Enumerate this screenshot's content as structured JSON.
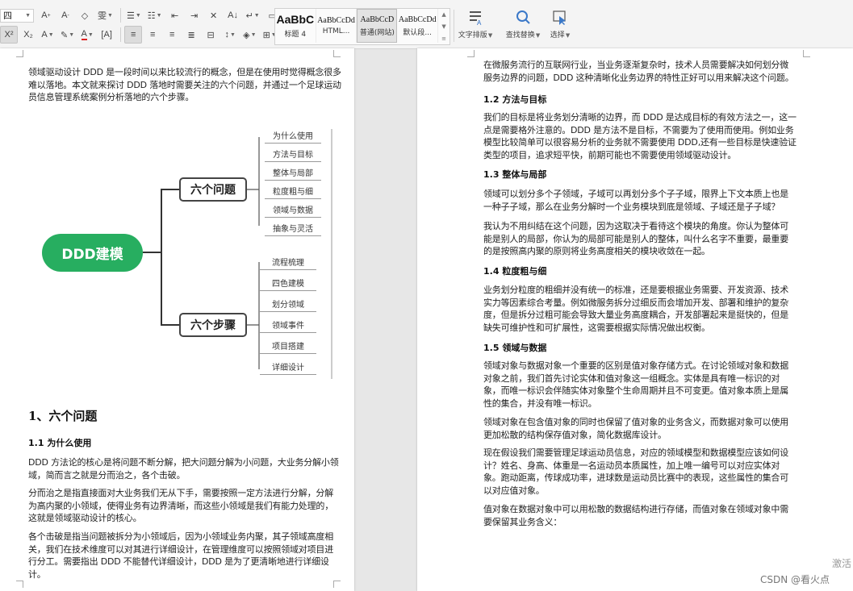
{
  "toolbar": {
    "font_size_value": "四",
    "style_gallery": [
      {
        "sample": "AaBbC",
        "name": "标题 4"
      },
      {
        "sample": "AaBbCcDd",
        "name": "HTML..."
      },
      {
        "sample": "AaBbCcD",
        "name": "普通(网站)"
      },
      {
        "sample": "AaBbCcDd",
        "name": "默认段..."
      }
    ],
    "text_layout_label": "文字排版",
    "find_replace_label": "查找替换",
    "select_label": "选择"
  },
  "left_page": {
    "intro": "领域驱动设计 DDD 是一段时间以来比较流行的概念，但是在使用时觉得概念很多难以落地。本文就来探讨 DDD 落地时需要关注的六个问题，并通过一个足球运动员信息管理系统案例分析落地的六个步骤。",
    "mindmap": {
      "root": "DDD建模",
      "branches": [
        {
          "label": "六个问题",
          "leaves": [
            "为什么使用",
            "方法与目标",
            "整体与局部",
            "粒度粗与细",
            "领域与数据",
            "抽象与灵活"
          ]
        },
        {
          "label": "六个步骤",
          "leaves": [
            "流程梳理",
            "四色建模",
            "划分领域",
            "领域事件",
            "项目搭建",
            "详细设计"
          ]
        }
      ]
    },
    "section_title": "1、六个问题",
    "subsection_title": "1.1  为什么使用",
    "paragraphs": [
      "DDD 方法论的核心是将问题不断分解，把大问题分解为小问题，大业务分解小领域，简而言之就是分而治之，各个击破。",
      "分而治之是指直接面对大业务我们无从下手，需要按照一定方法进行分解，分解为高内聚的小领域，使得业务有边界清晰，而这些小领域是我们有能力处理的，这就是领域驱动设计的核心。",
      "各个击破是指当问题被拆分为小领域后，因为小领域业务内聚，其子领域高度相关，我们在技术维度可以对其进行详细设计，在管理维度可以按照领域对项目进行分工。需要指出 DDD 不能替代详细设计，DDD 是为了更清晰地进行详细设计。"
    ]
  },
  "right_page": {
    "blocks": [
      {
        "type": "p",
        "text": "在微服务流行的互联网行业，当业务逐渐复杂时，技术人员需要解决如何划分微服务边界的问题，DDD 这种清晰化业务边界的特性正好可以用来解决这个问题。"
      },
      {
        "type": "h",
        "text": "1.2  方法与目标"
      },
      {
        "type": "p",
        "text": "我们的目标是将业务划分清晰的边界，而 DDD 是达成目标的有效方法之一，这一点是需要格外注意的。DDD 是方法不是目标，不需要为了使用而使用。例如业务模型比较简单可以很容易分析的业务就不需要使用 DDD,还有一些目标是快速验证类型的项目，追求短平快，前期可能也不需要使用领域驱动设计。"
      },
      {
        "type": "h",
        "text": "1.3  整体与局部"
      },
      {
        "type": "p",
        "text": "领域可以划分多个子领域，子域可以再划分多个子子域，限界上下文本质上也是一种子子域，那么在业务分解时一个业务模块到底是领域、子域还是子子域？"
      },
      {
        "type": "p",
        "text": "我认为不用纠结在这个问题，因为这取决于看待这个模块的角度。你认为整体可能是别人的局部，你认为的局部可能是别人的整体，叫什么名字不重要，最重要的是按照高内聚的原则将业务高度相关的模块收敛在一起。"
      },
      {
        "type": "h",
        "text": "1.4  粒度粗与细"
      },
      {
        "type": "p",
        "text": "业务划分粒度的粗细并没有统一的标准，还是要根据业务需要、开发资源、技术实力等因素综合考量。例如微服务拆分过细反而会增加开发、部署和维护的复杂度，但是拆分过粗可能会导致大量业务高度耦合，开发部署起来是挺快的，但是缺失可维护性和可扩展性，这需要根据实际情况做出权衡。"
      },
      {
        "type": "h",
        "text": "1.5  领域与数据"
      },
      {
        "type": "p",
        "text": "领域对象与数据对象一个重要的区别是值对象存储方式。在讨论领域对象和数据对象之前，我们首先讨论实体和值对象这一组概念。实体是具有唯一标识的对象，而唯一标识会伴随实体对象整个生命周期并且不可变更。值对象本质上是属性的集合，并没有唯一标识。"
      },
      {
        "type": "p",
        "text": "领域对象在包含值对象的同时也保留了值对象的业务含义，而数据对象可以使用更加松散的结构保存值对象，简化数据库设计。"
      },
      {
        "type": "p",
        "text": "现在假设我们需要管理足球运动员信息，对应的领域模型和数据模型应该如何设计？姓名、身高、体重是一名运动员本质属性，加上唯一编号可以对应实体对象。跑动距离，传球成功率，进球数是运动员比赛中的表现，这些属性的集合可以对应值对象。"
      },
      {
        "type": "p",
        "text": "值对象在数据对象中可以用松散的数据结构进行存储，而值对象在领域对象中需要保留其业务含义："
      }
    ]
  },
  "watermarks": {
    "activate": "激活",
    "csdn": "CSDN @看火点"
  }
}
